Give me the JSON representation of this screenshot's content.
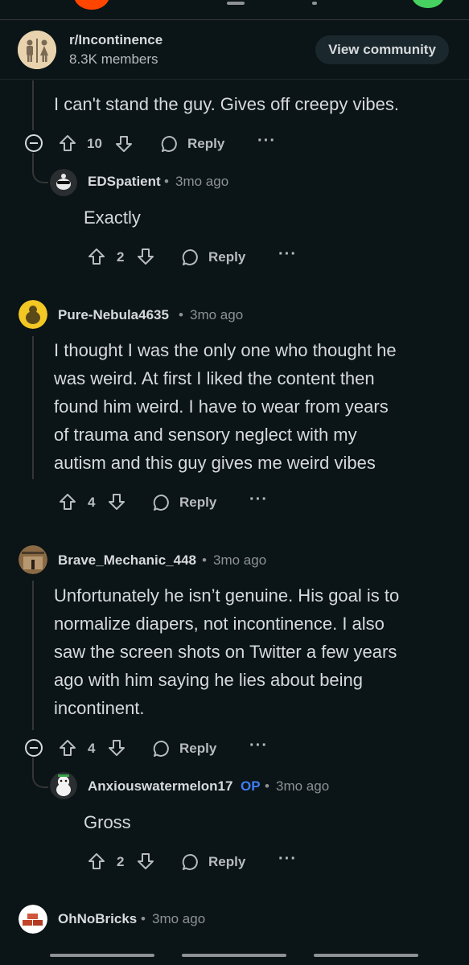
{
  "community": {
    "name": "r/Incontinence",
    "members": "8.3K members",
    "view_label": "View community"
  },
  "comments": {
    "c0": {
      "text": "I can't stand the guy. Gives off creepy vibes.",
      "votes": "10",
      "reply": "Reply",
      "more": "···"
    },
    "c1": {
      "user": "EDSpatient",
      "sep": "•",
      "time": "3mo ago",
      "text": "Exactly",
      "votes": "2",
      "reply": "Reply",
      "more": "···"
    },
    "c2": {
      "user": "Pure-Nebula4635",
      "sep": "•",
      "time": "3mo ago",
      "lines": [
        "I thought I was the only one who thought he",
        "was weird. At first I liked the content then",
        "found him weird. I have to wear from years",
        "of trauma and sensory neglect with my",
        "autism and this guy gives me weird vibes"
      ],
      "votes": "4",
      "reply": "Reply",
      "more": "···"
    },
    "c3": {
      "user": "Brave_Mechanic_448",
      "sep": "•",
      "time": "3mo ago",
      "lines": [
        "Unfortunately he isn’t genuine. His goal is to",
        "normalize diapers, not incontinence. I also",
        "saw the screen shots on Twitter a few years",
        "ago with him saying he lies about being",
        "incontinent."
      ],
      "votes": "4",
      "reply": "Reply",
      "more": "···"
    },
    "c4": {
      "user": "Anxiouswatermelon17",
      "op": "OP",
      "sep": "•",
      "time": "3mo ago",
      "text": "Gross",
      "votes": "2",
      "reply": "Reply",
      "more": "···"
    },
    "c5": {
      "user": "OhNoBricks",
      "sep": "•",
      "time": "3mo ago"
    }
  },
  "colors": {
    "background": "#0b1416",
    "text": "#d7dadc",
    "muted": "#8e9294",
    "op": "#3d7df5",
    "thread": "#343536"
  },
  "icons": [
    "upvote-icon",
    "downvote-icon",
    "reply-bubble-icon",
    "collapse-icon",
    "more-icon"
  ]
}
